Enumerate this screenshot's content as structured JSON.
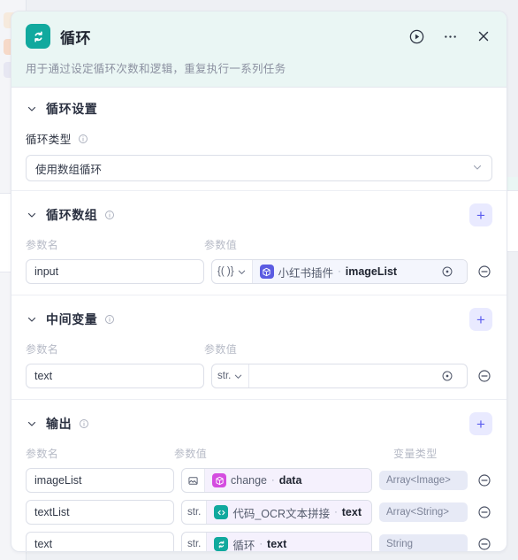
{
  "header": {
    "icon": "loop-icon",
    "title": "循环",
    "subtitle": "用于通过设定循环次数和逻辑，重复执行一系列任务",
    "actions": [
      {
        "name": "run-button",
        "icon": "play-circle-icon"
      },
      {
        "name": "more-button",
        "icon": "ellipsis-icon"
      },
      {
        "name": "close-button",
        "icon": "close-icon"
      }
    ]
  },
  "settings_section": {
    "title": "循环设置",
    "field_label": "循环类型",
    "select_value": "使用数组循环"
  },
  "loop_array_section": {
    "title": "循环数组",
    "add_label": "+",
    "columns": [
      "参数名",
      "参数值"
    ],
    "rows": [
      {
        "name": "input",
        "type_chip": "{( )}",
        "ref_icon": "cube-icon",
        "ref_icon_color": "#5b5ce2",
        "ref_node": "小红书插件",
        "ref_sep": "·",
        "ref_field": "imageList"
      }
    ]
  },
  "intermediate_section": {
    "title": "中间变量",
    "add_label": "+",
    "columns": [
      "参数名",
      "参数值"
    ],
    "rows": [
      {
        "name": "text",
        "type_chip": "str.",
        "ref_node": "",
        "ref_field": ""
      }
    ]
  },
  "output_section": {
    "title": "输出",
    "add_label": "+",
    "columns": [
      "参数名",
      "参数值",
      "变量类型"
    ],
    "rows": [
      {
        "name": "imageList",
        "type_chip": "image",
        "ref_icon": "cube-icon",
        "ref_icon_color": "#d44de0",
        "ref_node": "change",
        "ref_sep": "·",
        "ref_field": "data",
        "var_type": "Array<Image>"
      },
      {
        "name": "textList",
        "type_chip": "str.",
        "ref_icon": "code-icon",
        "ref_icon_color": "#11a99e",
        "ref_node": "代码_OCR文本拼接",
        "ref_sep": "·",
        "ref_field": "text",
        "var_type": "Array<String>"
      },
      {
        "name": "text",
        "type_chip": "str.",
        "ref_icon": "loop-icon",
        "ref_icon_color": "#11a99e",
        "ref_node": "循环",
        "ref_sep": "·",
        "ref_field": "text",
        "var_type": "String"
      }
    ]
  },
  "colors": {
    "accent_teal": "#11a99e",
    "accent_indigo": "#5d5fef",
    "header_bg": "#eaf6f4",
    "badge_bg": "#e7eaf6"
  }
}
